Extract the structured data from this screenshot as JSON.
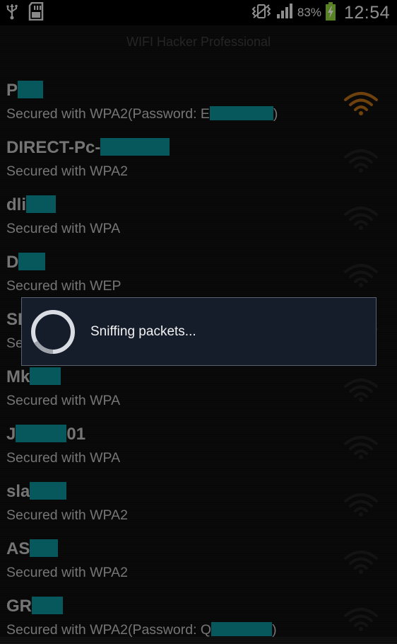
{
  "status_bar": {
    "icons_left": [
      "usb-icon",
      "sd-card-icon"
    ],
    "icons_right": [
      "vibrate-icon",
      "signal-icon",
      "battery-charging-icon"
    ],
    "battery_percent": "83%",
    "time": "12:54"
  },
  "app_title": "WIFI Hacker Professional",
  "networks": [
    {
      "ssid_prefix": "P",
      "ssid_suffix": "",
      "redact_w": 36,
      "security": "Secured with WPA2(Password: E",
      "sec_suffix": ")",
      "sec_redact_w": 90,
      "signal_color": "#b26a16",
      "signal_active": true
    },
    {
      "ssid_prefix": "DIRECT-Pc-",
      "ssid_suffix": "",
      "redact_w": 98,
      "security": "Secured with WPA2",
      "sec_suffix": "",
      "sec_redact_w": 0,
      "signal_color": "#1f1f1f",
      "signal_active": false
    },
    {
      "ssid_prefix": "dli",
      "ssid_suffix": "",
      "redact_w": 42,
      "security": "Secured with WPA",
      "sec_suffix": "",
      "sec_redact_w": 0,
      "signal_color": "#1f1f1f",
      "signal_active": false
    },
    {
      "ssid_prefix": "D",
      "ssid_suffix": "",
      "redact_w": 38,
      "security": "Secured with WEP",
      "sec_suffix": "",
      "sec_redact_w": 0,
      "signal_color": "#1f1f1f",
      "signal_active": false
    },
    {
      "ssid_prefix": "SI",
      "ssid_suffix": "",
      "redact_w": 0,
      "security": "Se",
      "sec_suffix": "",
      "sec_redact_w": 0,
      "signal_color": "#1f1f1f",
      "signal_active": false
    },
    {
      "ssid_prefix": "Mk",
      "ssid_suffix": "",
      "redact_w": 44,
      "security": "Secured with WPA",
      "sec_suffix": "",
      "sec_redact_w": 0,
      "signal_color": "#1f1f1f",
      "signal_active": false
    },
    {
      "ssid_prefix": "J",
      "ssid_suffix": "01",
      "redact_w": 72,
      "security": "Secured with WPA",
      "sec_suffix": "",
      "sec_redact_w": 0,
      "signal_color": "#1f1f1f",
      "signal_active": false
    },
    {
      "ssid_prefix": "sla",
      "ssid_suffix": "",
      "redact_w": 52,
      "security": "Secured with WPA2",
      "sec_suffix": "",
      "sec_redact_w": 0,
      "signal_color": "#1f1f1f",
      "signal_active": false
    },
    {
      "ssid_prefix": "AS",
      "ssid_suffix": "",
      "redact_w": 40,
      "security": "Secured with WPA2",
      "sec_suffix": "",
      "sec_redact_w": 0,
      "signal_color": "#1f1f1f",
      "signal_active": false
    },
    {
      "ssid_prefix": "GR",
      "ssid_suffix": "",
      "redact_w": 44,
      "security": "Secured with WPA2(Password: Q",
      "sec_suffix": ")",
      "sec_redact_w": 86,
      "signal_color": "#1f1f1f",
      "signal_active": false
    }
  ],
  "dialog": {
    "message": "Sniffing packets...",
    "spinner_icon": "progress-spinner-icon"
  }
}
